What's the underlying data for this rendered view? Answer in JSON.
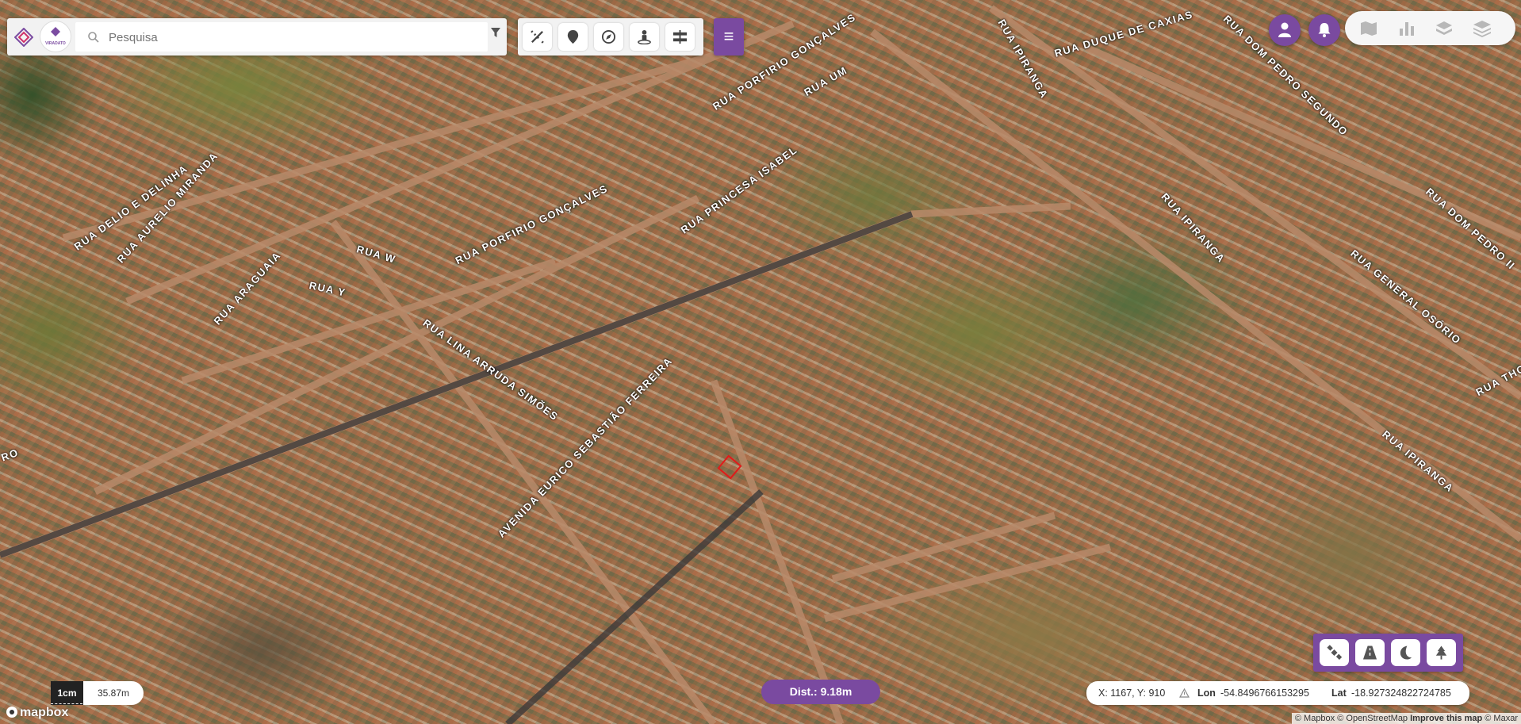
{
  "search": {
    "placeholder": "Pesquisa",
    "logo_text": "VIRADATO"
  },
  "menu": {
    "icon": "≡"
  },
  "streets": [
    "RUA DELIO E DELINHA",
    "RUA AURELIO MIRANDA",
    "RUA ARAGUAIA",
    "RUA Y",
    "RUA W",
    "RUA PORFIRIO GONÇALVES",
    "RUA PORFIRIO GONÇALVES",
    "RUA UM",
    "RUA PRINCESA ISABEL",
    "RUA LINA ARRUDA SIMÕES",
    "AVENIDA EURICO SEBASTIÃO FERREIRA",
    "RUA IPIRANGA",
    "RUA DUQUE DE CAXIAS",
    "RUA DOM PEDRO SEGUNDO",
    "RUA IPIRANGA",
    "RUA DOM PEDRO II",
    "RUA GENERAL OSÓRIO",
    "RUA IPIRANGA",
    "RUA THO",
    "RO"
  ],
  "distance": {
    "label": "Dist.: 9.18m"
  },
  "scale": {
    "unit": "1cm",
    "value": "35.87m"
  },
  "coordinates": {
    "xy": "X: 1167, Y: 910",
    "lon_label": "Lon",
    "lon": "-54.8496766153295",
    "lat_label": "Lat",
    "lat": "-18.927324822724785"
  },
  "attribution": {
    "mapbox": "© Mapbox",
    "osm": "© OpenStreetMap",
    "improve": "Improve this map",
    "maxar": "© Maxar"
  },
  "mapbox_logo": "mapbox",
  "icons": {
    "tools": [
      "measure-icon",
      "location-pin-icon",
      "compass-icon",
      "street-view-icon",
      "road-icon"
    ],
    "top_right": [
      "user-icon",
      "bell-icon"
    ],
    "layers": [
      "map-layer-icon",
      "chart-icon",
      "terrain-layer-icon",
      "layers-stack-icon"
    ],
    "bottom": [
      "satellite-icon",
      "road-perspective-icon",
      "moon-icon",
      "tree-icon"
    ]
  },
  "colors": {
    "accent": "#7a4aa0",
    "marker": "#e01b1b"
  }
}
